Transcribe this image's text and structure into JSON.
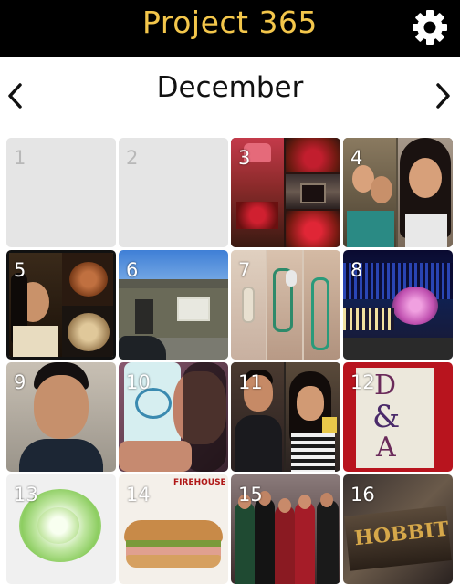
{
  "app": {
    "title": "Project 365",
    "settings_icon": "gear-icon"
  },
  "calendar": {
    "month": "December",
    "prev_icon": "chevron-left-icon",
    "next_icon": "chevron-right-icon"
  },
  "days": [
    {
      "num": "1",
      "photo": "none"
    },
    {
      "num": "2",
      "photo": "none"
    },
    {
      "num": "3",
      "photo": "holiday-decor-collage"
    },
    {
      "num": "4",
      "photo": "selfie-collage"
    },
    {
      "num": "5",
      "photo": "dinner-collage"
    },
    {
      "num": "6",
      "photo": "house-exterior"
    },
    {
      "num": "7",
      "photo": "bracelets-collage"
    },
    {
      "num": "8",
      "photo": "christmas-lights"
    },
    {
      "num": "9",
      "photo": "portrait-man"
    },
    {
      "num": "10",
      "photo": "monogram-phone-case"
    },
    {
      "num": "11",
      "photo": "couple-collage"
    },
    {
      "num": "12",
      "photo": "d-and-a-sign"
    },
    {
      "num": "13",
      "photo": "paper-flower"
    },
    {
      "num": "14",
      "photo": "firehouse-subs-sandwich"
    },
    {
      "num": "15",
      "photo": "group-photo"
    },
    {
      "num": "16",
      "photo": "hobbit-ticket"
    }
  ],
  "photo_text": {
    "day12_line1": "D",
    "day12_line2": "&",
    "day12_line3": "A",
    "day14_logo": "FIREHOUSE",
    "day16_title": "HOBBIT"
  },
  "colors": {
    "topbar_bg": "#000000",
    "title_color": "#f3c64b",
    "empty_cell": "#e5e5e5"
  }
}
